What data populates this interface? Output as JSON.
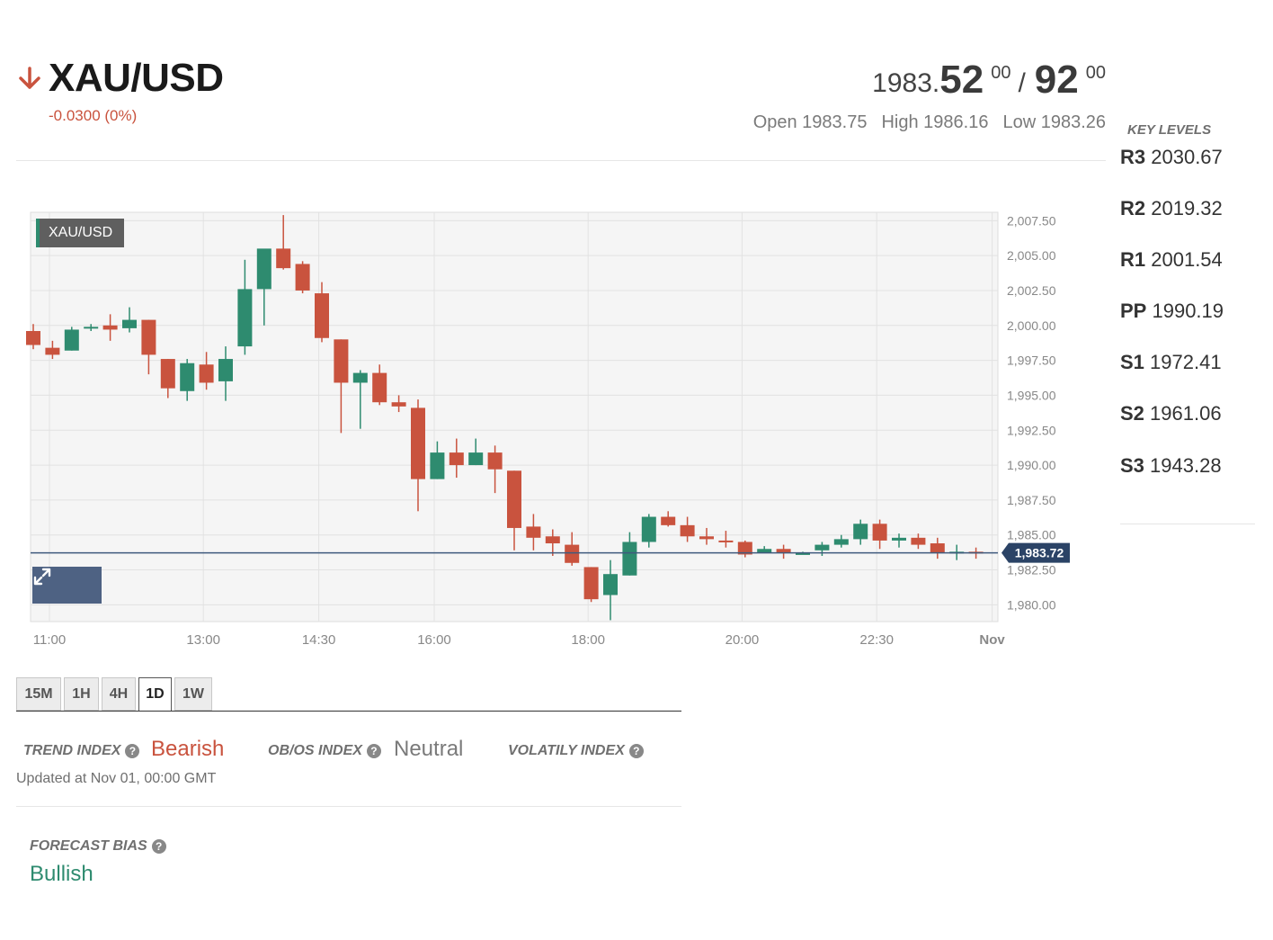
{
  "instrument": {
    "symbol": "XAU/USD",
    "change": "-0.0300 (0%)",
    "direction_icon": "arrow-down-icon",
    "down_color": "#c9533e",
    "up_color": "#2e8b6f"
  },
  "quote": {
    "bid_int": "1983.",
    "bid_big": "52",
    "bid_sup": "00",
    "slash": "/",
    "ask_big": "92",
    "ask_sup": "00",
    "open": "Open 1983.75",
    "high": "High 1986.16",
    "low": "Low 1983.26"
  },
  "key_levels": {
    "title": "KEY LEVELS",
    "items": [
      {
        "label": "R3",
        "value": "2030.67"
      },
      {
        "label": "R2",
        "value": "2019.32"
      },
      {
        "label": "R1",
        "value": "2001.54"
      },
      {
        "label": "PP",
        "value": "1990.19"
      },
      {
        "label": "S1",
        "value": "1972.41"
      },
      {
        "label": "S2",
        "value": "1961.06"
      },
      {
        "label": "S3",
        "value": "1943.28"
      }
    ]
  },
  "chart": {
    "legend": "XAU/USD",
    "expand_icon": "expand-icon"
  },
  "timeframes": [
    "15M",
    "1H",
    "4H",
    "1D",
    "1W"
  ],
  "active_timeframe": "1D",
  "indices": {
    "trend": {
      "label": "TREND INDEX",
      "value": "Bearish"
    },
    "obos": {
      "label": "OB/OS INDEX",
      "value": "Neutral"
    },
    "volatility": {
      "label": "VOLATILY INDEX",
      "value": ""
    }
  },
  "help_icon": "question-circle-icon",
  "updated": "Updated at Nov 01, 00:00 GMT",
  "forecast": {
    "label": "FORECAST BIAS",
    "value": "Bullish"
  },
  "chart_data": {
    "type": "candlestick",
    "title": "XAU/USD",
    "y_ticks": [
      "2,007.50",
      "2,005.00",
      "2,002.50",
      "2,000.00",
      "1,997.50",
      "1,995.00",
      "1,992.50",
      "1,990.00",
      "1,987.50",
      "1,985.00",
      "1,982.50",
      "1,980.00"
    ],
    "ylim": [
      1978.8,
      2008.1
    ],
    "x_ticks": [
      {
        "label": "11:00",
        "index": 0
      },
      {
        "label": "13:00",
        "index": 8
      },
      {
        "label": "14:30",
        "index": 14
      },
      {
        "label": "16:00",
        "index": 20
      },
      {
        "label": "18:00",
        "index": 28
      },
      {
        "label": "20:00",
        "index": 36
      },
      {
        "label": "22:30",
        "index": 43
      },
      {
        "label": "Nov",
        "index": 49
      }
    ],
    "current_price": 1983.72,
    "current_price_label": "1,983.72",
    "grid": true,
    "candles": [
      {
        "o": 1999.6,
        "h": 2000.1,
        "l": 1998.3,
        "c": 1998.6
      },
      {
        "o": 1998.4,
        "h": 1998.9,
        "l": 1997.6,
        "c": 1997.9
      },
      {
        "o": 1998.2,
        "h": 1999.9,
        "l": 1998.2,
        "c": 1999.7
      },
      {
        "o": 1999.8,
        "h": 2000.1,
        "l": 1999.6,
        "c": 1999.9
      },
      {
        "o": 2000.0,
        "h": 2000.8,
        "l": 1998.9,
        "c": 1999.7
      },
      {
        "o": 1999.8,
        "h": 2001.3,
        "l": 1999.5,
        "c": 2000.4
      },
      {
        "o": 2000.4,
        "h": 2000.4,
        "l": 1996.5,
        "c": 1997.9
      },
      {
        "o": 1997.6,
        "h": 1997.6,
        "l": 1994.8,
        "c": 1995.5
      },
      {
        "o": 1995.3,
        "h": 1997.6,
        "l": 1994.6,
        "c": 1997.3
      },
      {
        "o": 1997.2,
        "h": 1998.1,
        "l": 1995.4,
        "c": 1995.9
      },
      {
        "o": 1996.0,
        "h": 1998.5,
        "l": 1994.6,
        "c": 1997.6
      },
      {
        "o": 1998.5,
        "h": 2004.7,
        "l": 1997.9,
        "c": 2002.6
      },
      {
        "o": 2002.6,
        "h": 2005.3,
        "l": 2000.0,
        "c": 2005.5
      },
      {
        "o": 2005.5,
        "h": 2007.9,
        "l": 2004.0,
        "c": 2004.1
      },
      {
        "o": 2004.4,
        "h": 2004.6,
        "l": 2002.3,
        "c": 2002.5
      },
      {
        "o": 2002.3,
        "h": 2003.1,
        "l": 1998.8,
        "c": 1999.1
      },
      {
        "o": 1999.0,
        "h": 1999.0,
        "l": 1992.3,
        "c": 1995.9
      },
      {
        "o": 1995.9,
        "h": 1996.8,
        "l": 1992.6,
        "c": 1996.6
      },
      {
        "o": 1996.6,
        "h": 1997.2,
        "l": 1994.3,
        "c": 1994.5
      },
      {
        "o": 1994.5,
        "h": 1995.0,
        "l": 1993.8,
        "c": 1994.2
      },
      {
        "o": 1994.1,
        "h": 1994.7,
        "l": 1986.7,
        "c": 1989.0
      },
      {
        "o": 1989.0,
        "h": 1991.7,
        "l": 1989.0,
        "c": 1990.9
      },
      {
        "o": 1990.9,
        "h": 1991.9,
        "l": 1989.1,
        "c": 1990.0
      },
      {
        "o": 1990.0,
        "h": 1991.9,
        "l": 1990.0,
        "c": 1990.9
      },
      {
        "o": 1990.9,
        "h": 1991.4,
        "l": 1988.0,
        "c": 1989.7
      },
      {
        "o": 1989.6,
        "h": 1989.6,
        "l": 1983.9,
        "c": 1985.5
      },
      {
        "o": 1985.6,
        "h": 1986.5,
        "l": 1983.9,
        "c": 1984.8
      },
      {
        "o": 1984.9,
        "h": 1985.4,
        "l": 1983.5,
        "c": 1984.4
      },
      {
        "o": 1984.3,
        "h": 1985.2,
        "l": 1982.8,
        "c": 1983.0
      },
      {
        "o": 1982.7,
        "h": 1982.7,
        "l": 1980.2,
        "c": 1980.4
      },
      {
        "o": 1980.7,
        "h": 1983.2,
        "l": 1978.9,
        "c": 1982.2
      },
      {
        "o": 1982.1,
        "h": 1985.2,
        "l": 1982.1,
        "c": 1984.5
      },
      {
        "o": 1984.5,
        "h": 1986.5,
        "l": 1984.1,
        "c": 1986.3
      },
      {
        "o": 1986.3,
        "h": 1986.7,
        "l": 1985.6,
        "c": 1985.7
      },
      {
        "o": 1985.7,
        "h": 1986.3,
        "l": 1984.5,
        "c": 1984.9
      },
      {
        "o": 1984.9,
        "h": 1985.5,
        "l": 1984.3,
        "c": 1984.7
      },
      {
        "o": 1984.6,
        "h": 1985.3,
        "l": 1984.1,
        "c": 1984.5
      },
      {
        "o": 1984.5,
        "h": 1984.6,
        "l": 1983.4,
        "c": 1983.6
      },
      {
        "o": 1983.7,
        "h": 1984.2,
        "l": 1983.7,
        "c": 1984.0
      },
      {
        "o": 1984.0,
        "h": 1984.3,
        "l": 1983.3,
        "c": 1983.7
      },
      {
        "o": 1983.7,
        "h": 1983.8,
        "l": 1983.6,
        "c": 1983.7
      },
      {
        "o": 1983.9,
        "h": 1984.5,
        "l": 1983.5,
        "c": 1984.3
      },
      {
        "o": 1984.3,
        "h": 1985.0,
        "l": 1984.1,
        "c": 1984.7
      },
      {
        "o": 1984.7,
        "h": 1986.1,
        "l": 1984.3,
        "c": 1985.8
      },
      {
        "o": 1985.8,
        "h": 1986.1,
        "l": 1984.0,
        "c": 1984.6
      },
      {
        "o": 1984.6,
        "h": 1985.1,
        "l": 1984.1,
        "c": 1984.8
      },
      {
        "o": 1984.8,
        "h": 1985.1,
        "l": 1984.0,
        "c": 1984.3
      },
      {
        "o": 1984.4,
        "h": 1984.8,
        "l": 1983.3,
        "c": 1983.7
      },
      {
        "o": 1983.7,
        "h": 1984.3,
        "l": 1983.2,
        "c": 1983.8
      },
      {
        "o": 1983.8,
        "h": 1984.1,
        "l": 1983.3,
        "c": 1983.7
      }
    ]
  }
}
